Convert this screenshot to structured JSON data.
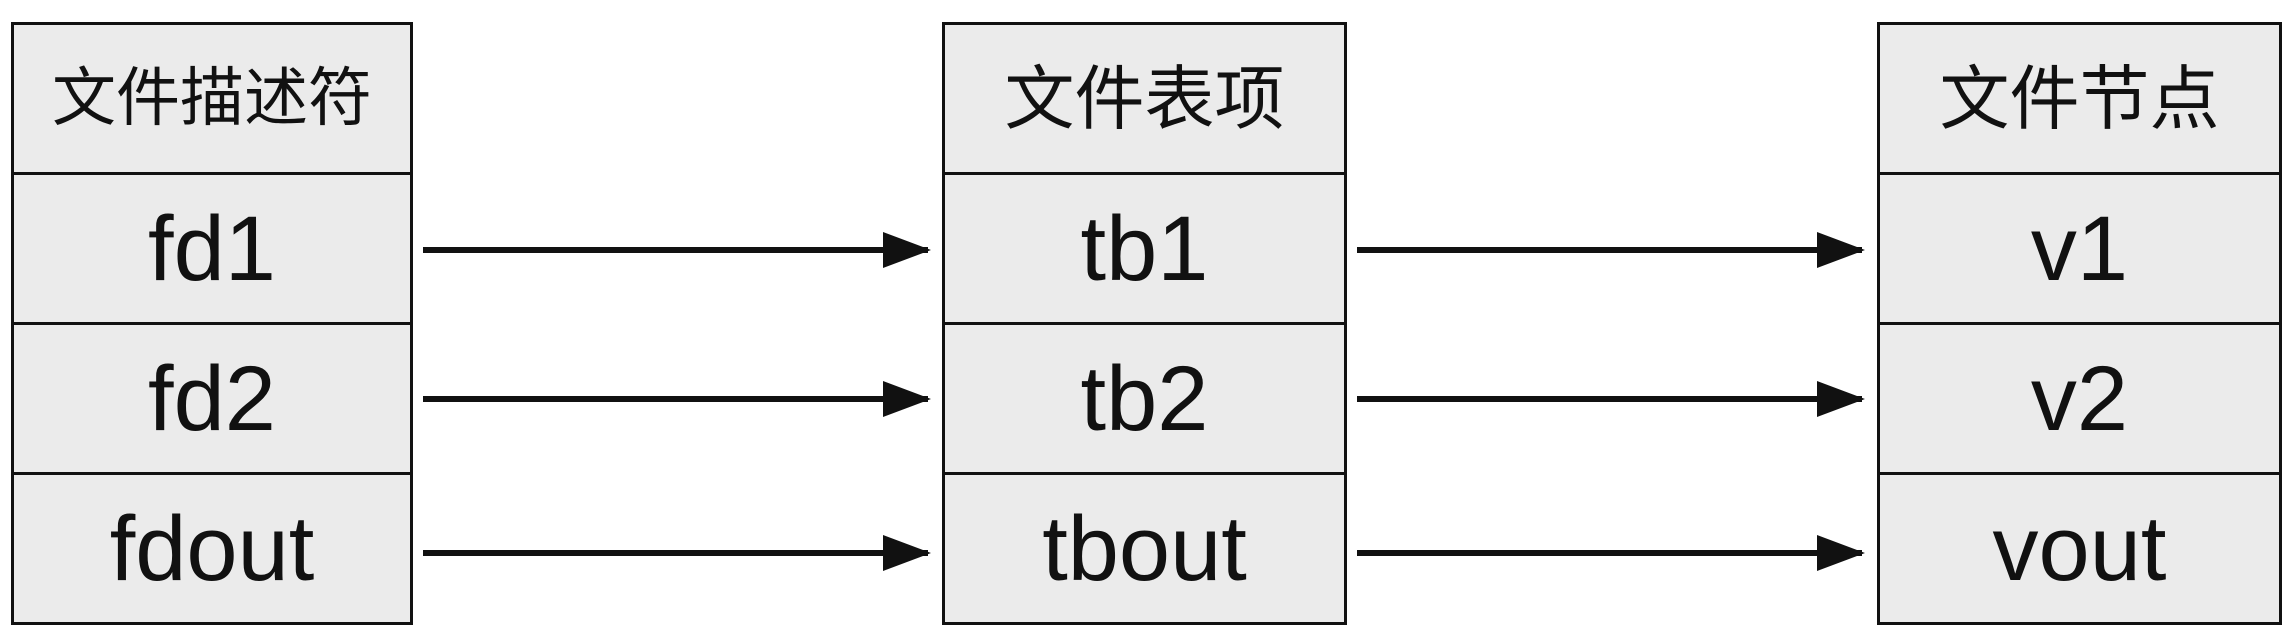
{
  "tables": {
    "fd": {
      "header": "文件描述符",
      "rows": [
        "fd1",
        "fd2",
        "fdout"
      ]
    },
    "tb": {
      "header": "文件表项",
      "rows": [
        "tb1",
        "tb2",
        "tbout"
      ]
    },
    "v": {
      "header": "文件节点",
      "rows": [
        "v1",
        "v2",
        "vout"
      ]
    }
  },
  "colors": {
    "cell_fill": "#ebebeb",
    "stroke": "#111111"
  }
}
